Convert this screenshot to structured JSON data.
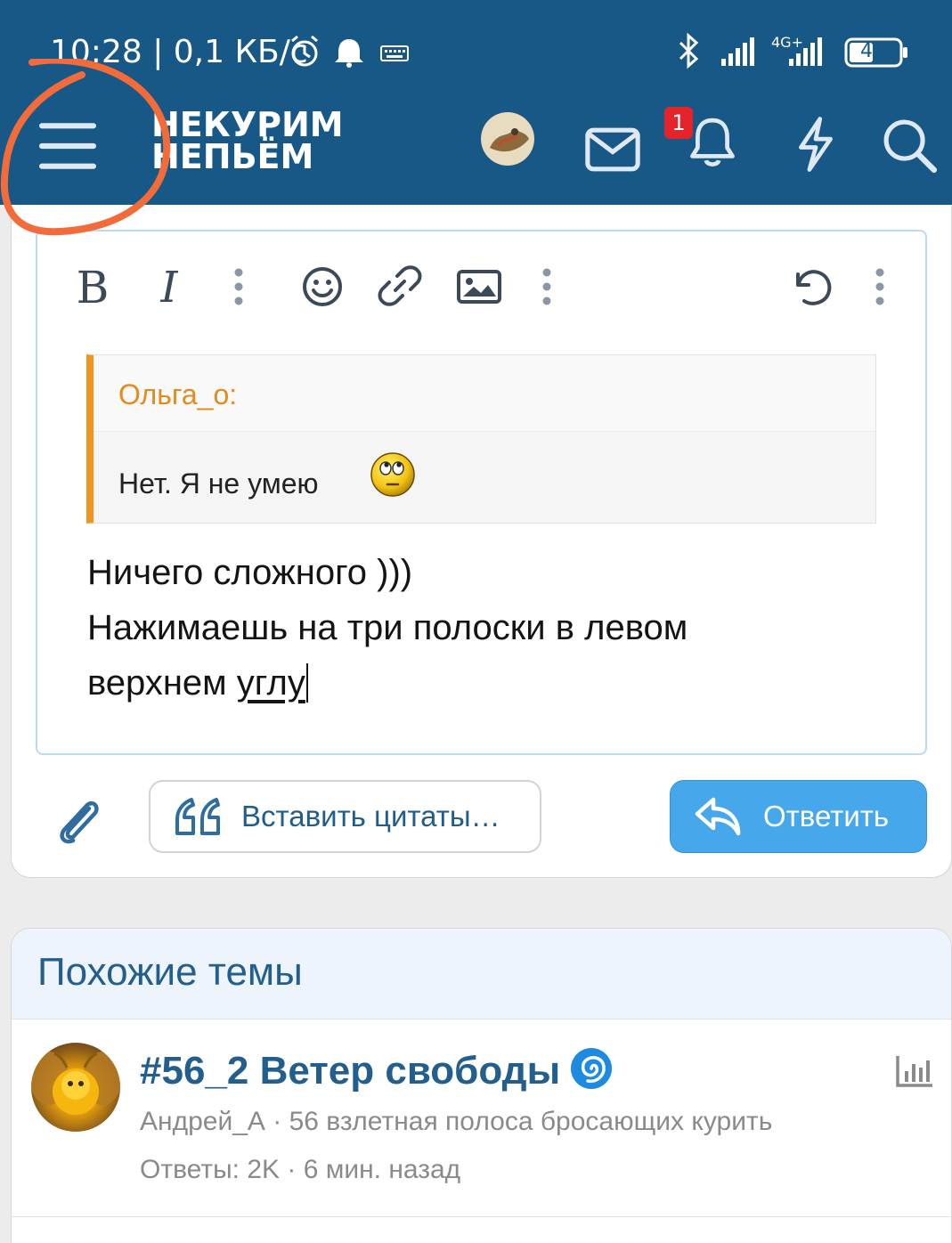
{
  "status_bar": {
    "time_speed": "10:28 | 0,1 КБ/с",
    "network": "4G+",
    "battery": "47"
  },
  "nav": {
    "logo_line1": "НЕКУРИМ",
    "logo_line2": "НЕПЬЁМ",
    "notification_count": "1"
  },
  "toolbar": {
    "bold": "B",
    "italic": "I"
  },
  "quote": {
    "author": "Ольга_о:",
    "text": "Нет. Я не умею"
  },
  "message": {
    "line1": "Ничего сложного )))",
    "line2": "Нажимаешь на три полоски в левом",
    "line3_start": "верхнем ",
    "line3_end": "углу"
  },
  "actions": {
    "insert_quotes": "Вставить цитаты…",
    "reply": "Ответить"
  },
  "similar": {
    "title": "Похожие темы",
    "threads": [
      {
        "title": "#56_2 Ветер свободы",
        "meta": "Андрей_А · 56 взлетная полоса бросающих курить",
        "stats": "Ответы: 2K · 6 мин. назад"
      }
    ]
  },
  "colors": {
    "header": "#185886",
    "accent": "#47a7eb",
    "quote_border": "#f2951f",
    "annotation": "#f26b3a"
  }
}
